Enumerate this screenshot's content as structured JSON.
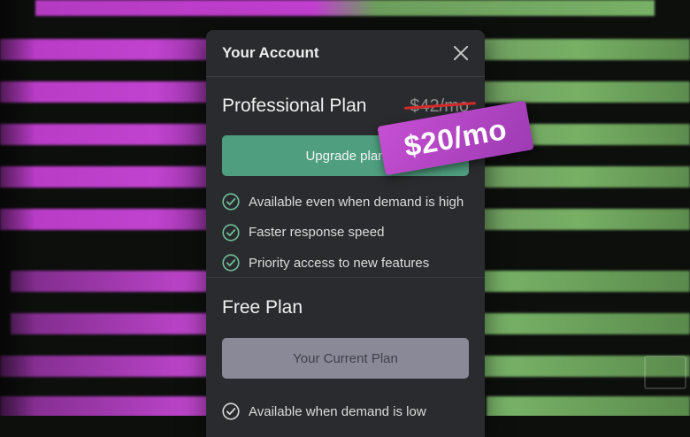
{
  "modal": {
    "title": "Your Account"
  },
  "professional": {
    "name": "Professional Plan",
    "old_price": "$42/mo",
    "button_label": "Upgrade plan",
    "features": [
      "Available even when demand is high",
      "Faster response speed",
      "Priority access to new features"
    ]
  },
  "free": {
    "name": "Free Plan",
    "button_label": "Your Current Plan",
    "features": [
      "Available when demand is low"
    ]
  },
  "badge": {
    "price": "$20/mo"
  },
  "colors": {
    "upgrade_button": "#4f9e7f",
    "badge": "#b545c8",
    "strike": "#d42a2a",
    "check": "#6fbf9a"
  },
  "icons": {
    "close": "close-icon",
    "check": "check-circle-icon"
  }
}
